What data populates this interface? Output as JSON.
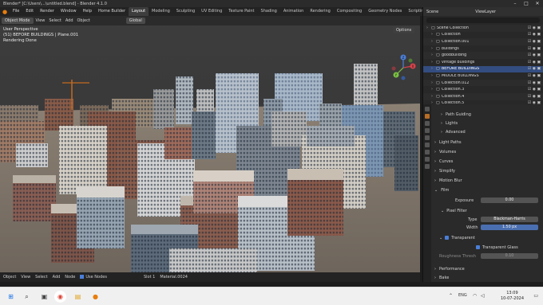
{
  "title_bar": {
    "title": "Blender* [C:\\Users\\...\\untitled.blend] - Blender 4.1.0",
    "controls": [
      "–",
      "□",
      "✕"
    ]
  },
  "menu": {
    "items": [
      "File",
      "Edit",
      "Render",
      "Window",
      "Help",
      "Home Builder"
    ],
    "workspaces": [
      "Layout",
      "Modeling",
      "Sculpting",
      "UV Editing",
      "Texture Paint",
      "Shading",
      "Animation",
      "Rendering",
      "Compositing",
      "Geometry Nodes",
      "Scripting"
    ],
    "active_workspace": "Layout",
    "scene_label": "Scene",
    "view_layer_label": "ViewLayer"
  },
  "viewport_header": {
    "mode": "Object Mode",
    "items": [
      "View",
      "Select",
      "Add",
      "Object"
    ],
    "transform": "Global",
    "options_label": "Options"
  },
  "viewport_info": {
    "line1": "User Perspective",
    "line2": "(51) BEFORE BUILDINGS | Plane.001",
    "line3": "Rendering Done"
  },
  "gizmo": {
    "x": "X",
    "y": "Y",
    "z": "Z"
  },
  "status_bar": {
    "mode": "Object",
    "items": [
      "View",
      "Select",
      "Add",
      "Node"
    ],
    "use_nodes": "Use Nodes",
    "slot": "Slot 1",
    "material": "Material.0024"
  },
  "outliner": {
    "header": [
      "Scene Collection"
    ],
    "rows": [
      {
        "name": "Scene Collection",
        "indent": 0,
        "selected": false
      },
      {
        "name": "Collection",
        "indent": 1,
        "selected": false
      },
      {
        "name": "Collection.001",
        "indent": 1,
        "selected": false
      },
      {
        "name": "buildings",
        "indent": 1,
        "selected": false
      },
      {
        "name": "goodbuilding",
        "indent": 1,
        "selected": false
      },
      {
        "name": "vintage buildings",
        "indent": 1,
        "selected": false
      },
      {
        "name": "BEFORE BUILDINGS",
        "indent": 1,
        "selected": true
      },
      {
        "name": "MIDDLE BUILDINGS",
        "indent": 1,
        "selected": false
      },
      {
        "name": "Collection.012",
        "indent": 1,
        "selected": false
      },
      {
        "name": "Collection.3",
        "indent": 1,
        "selected": false
      },
      {
        "name": "Collection.4",
        "indent": 1,
        "selected": false
      },
      {
        "name": "Collection.5",
        "indent": 1,
        "selected": false
      }
    ]
  },
  "properties": {
    "rows": [
      {
        "label": "Path Guiding",
        "type": "section-sub"
      },
      {
        "label": "Lights",
        "type": "section-sub"
      },
      {
        "label": "Advanced",
        "type": "section-sub"
      },
      {
        "label": "Light Paths",
        "type": "section"
      },
      {
        "label": "Volumes",
        "type": "section"
      },
      {
        "label": "Curves",
        "type": "section"
      },
      {
        "label": "Simplify",
        "type": "section"
      },
      {
        "label": "Motion Blur",
        "type": "section"
      },
      {
        "label": "Film",
        "type": "section-open"
      }
    ],
    "exposure_label": "Exposure",
    "exposure_value": "0.00",
    "pixel_filter_label": "Pixel Filter",
    "type_label": "Type",
    "type_value": "Blackman-Harris",
    "width_label": "Width",
    "width_value": "1.50 px",
    "transparent_label": "Transparent",
    "transparent_glass_label": "Transparent Glass",
    "roughness_label": "Roughness Thresh",
    "roughness_value": "0.10",
    "performance_label": "Performance",
    "bake_label": "Bake"
  },
  "taskbar": {
    "time": "13:09",
    "date": "10-07-2024",
    "lang": "ENG"
  }
}
